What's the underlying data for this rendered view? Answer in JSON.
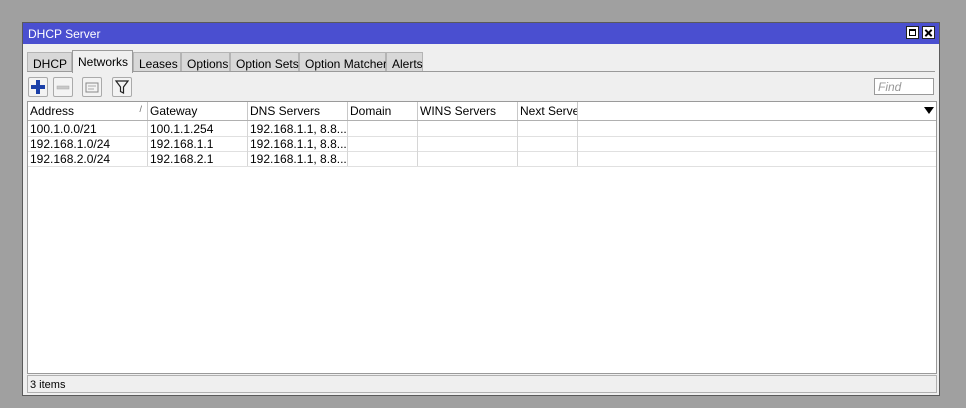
{
  "window": {
    "title": "DHCP Server"
  },
  "tabs": [
    {
      "label": "DHCP"
    },
    {
      "label": "Networks",
      "active": true
    },
    {
      "label": "Leases"
    },
    {
      "label": "Options"
    },
    {
      "label": "Option Sets"
    },
    {
      "label": "Option Matcher"
    },
    {
      "label": "Alerts"
    }
  ],
  "toolbar": {
    "add_icon": "plus-icon",
    "remove_icon": "minus-icon",
    "comment_icon": "note-icon",
    "filter_icon": "filter-icon",
    "find_placeholder": "Find"
  },
  "table": {
    "columns": [
      "Address",
      "Gateway",
      "DNS Servers",
      "Domain",
      "WINS Servers",
      "Next Server"
    ],
    "sort_mark": "/",
    "rows": [
      [
        "100.1.0.0/21",
        "100.1.1.254",
        "192.168.1.1, 8.8....",
        "",
        "",
        ""
      ],
      [
        "192.168.1.0/24",
        "192.168.1.1",
        "192.168.1.1, 8.8....",
        "",
        "",
        ""
      ],
      [
        "192.168.2.0/24",
        "192.168.2.1",
        "192.168.1.1, 8.8....",
        "",
        "",
        ""
      ]
    ]
  },
  "status": {
    "text": "3 items"
  },
  "colors": {
    "titlebar": "#4a4fd0",
    "add_icon": "#1a3fa8"
  }
}
